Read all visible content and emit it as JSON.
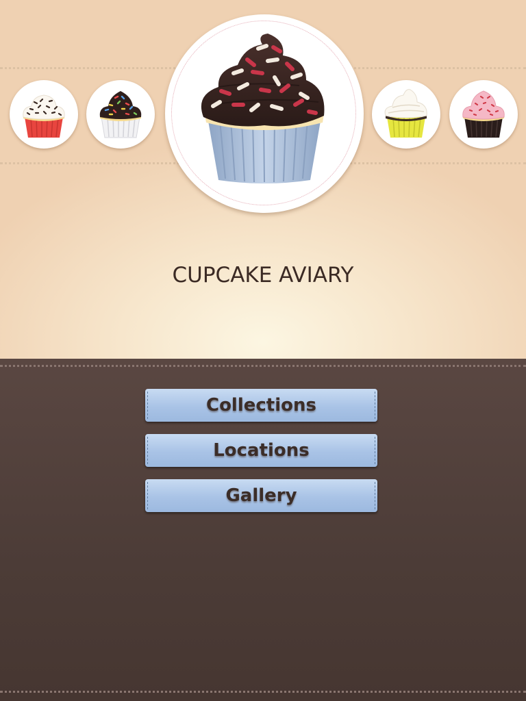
{
  "app": {
    "title": "CUPCAKE AVIARY"
  },
  "carousel": {
    "items": [
      {
        "icon": "cupcake-white-frosting-red-liner-icon",
        "frosting": "#fbf7f0",
        "liner": "#e8453f",
        "sprinkles": "#3a2a24"
      },
      {
        "icon": "cupcake-chocolate-rainbow-sprinkles-white-liner-icon",
        "frosting": "#2f1f1c",
        "liner": "#f2f2f4",
        "sprinkles": "rainbow"
      },
      {
        "icon": "cupcake-chocolate-sprinkles-blue-liner-icon",
        "frosting": "#3a2522",
        "liner": "#a7bcd6",
        "sprinkles": "#d8d2c4"
      },
      {
        "icon": "cupcake-white-frosting-yellow-liner-icon",
        "frosting": "#fbf8f1",
        "liner": "#e6e640",
        "sprinkles": "none"
      },
      {
        "icon": "cupcake-pink-frosting-black-liner-icon",
        "frosting": "#f5b8c6",
        "liner": "#2a1d1b",
        "sprinkles": "#d03a48"
      }
    ],
    "selected_index": 2
  },
  "menu": {
    "buttons": [
      {
        "label": "Collections"
      },
      {
        "label": "Locations"
      },
      {
        "label": "Gallery"
      }
    ]
  },
  "colors": {
    "top_background": "#f7e6cc",
    "bottom_background": "#4c3c37",
    "button_fill": "#a9c3e6",
    "title_text": "#3b2a24"
  }
}
